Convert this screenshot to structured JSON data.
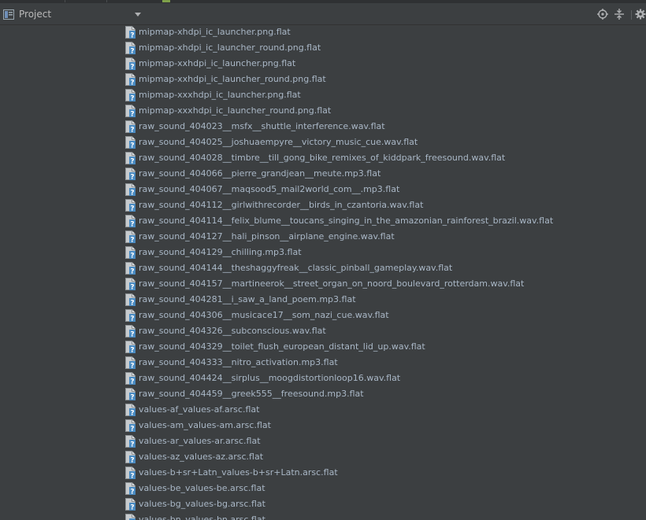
{
  "panel": {
    "title": "Project",
    "icons": {
      "view": "project-view-icon",
      "dropdown": "chevron-down-icon",
      "locate": "crosshair-icon",
      "collapse": "collapse-all-icon",
      "settings": "gear-icon"
    }
  },
  "tree": {
    "file_icon": "unknown-file-icon",
    "text_color": "#a9b7c6",
    "files": [
      "mipmap-xhdpi_ic_launcher.png.flat",
      "mipmap-xhdpi_ic_launcher_round.png.flat",
      "mipmap-xxhdpi_ic_launcher.png.flat",
      "mipmap-xxhdpi_ic_launcher_round.png.flat",
      "mipmap-xxxhdpi_ic_launcher.png.flat",
      "mipmap-xxxhdpi_ic_launcher_round.png.flat",
      "raw_sound_404023__msfx__shuttle_interference.wav.flat",
      "raw_sound_404025__joshuaempyre__victory_music_cue.wav.flat",
      "raw_sound_404028__timbre__till_gong_bike_remixes_of_kiddpark_freesound.wav.flat",
      "raw_sound_404066__pierre_grandjean__meute.mp3.flat",
      "raw_sound_404067__maqsood5_mail2world_com__.mp3.flat",
      "raw_sound_404112__girlwithrecorder__birds_in_czantoria.wav.flat",
      "raw_sound_404114__felix_blume__toucans_singing_in_the_amazonian_rainforest_brazil.wav.flat",
      "raw_sound_404127__hali_pinson__airplane_engine.wav.flat",
      "raw_sound_404129__chilling.mp3.flat",
      "raw_sound_404144__theshaggyfreak__classic_pinball_gameplay.wav.flat",
      "raw_sound_404157__martineerok__street_organ_on_noord_boulevard_rotterdam.wav.flat",
      "raw_sound_404281__i_saw_a_land_poem.mp3.flat",
      "raw_sound_404306__musicace17__som_nazi_cue.wav.flat",
      "raw_sound_404326__subconscious.wav.flat",
      "raw_sound_404329__toilet_flush_european_distant_lid_up.wav.flat",
      "raw_sound_404333__nitro_activation.mp3.flat",
      "raw_sound_404424__sirplus__moogdistortionloop16.wav.flat",
      "raw_sound_404459__greek555__freesound.mp3.flat",
      "values-af_values-af.arsc.flat",
      "values-am_values-am.arsc.flat",
      "values-ar_values-ar.arsc.flat",
      "values-az_values-az.arsc.flat",
      "values-b+sr+Latn_values-b+sr+Latn.arsc.flat",
      "values-be_values-be.arsc.flat",
      "values-bg_values-bg.arsc.flat",
      "values-bn_values-bn.arsc.flat"
    ]
  }
}
